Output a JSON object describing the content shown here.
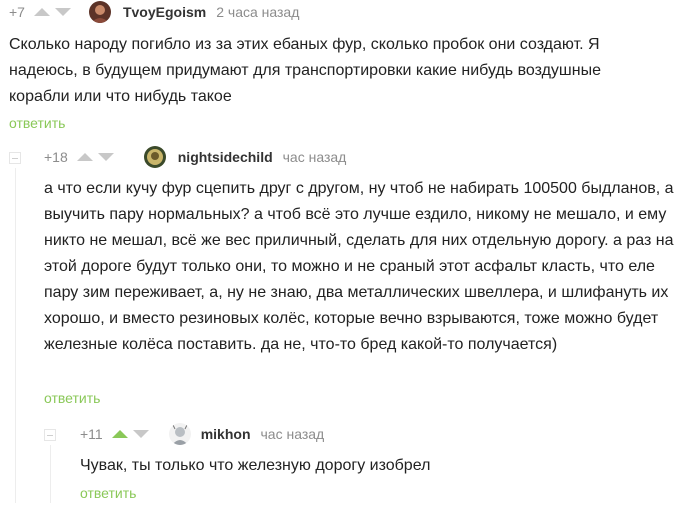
{
  "comments": [
    {
      "rating": "+7",
      "author": "TvoyEgoism",
      "time": "2 часа назад",
      "avatar_color": "#8a4a3a",
      "text": "Сколько народу погибло из за этих ебаных фур, сколько пробок они создают. Я надеюсь, в будущем придумают для транспортировки какие нибудь воздушные корабли или что нибудь такое",
      "reply_label": "ответить"
    },
    {
      "rating": "+18",
      "author": "nightsidechild",
      "time": "час назад",
      "avatar_color": "#5a6e3a",
      "text": "а что если кучу фур сцепить друг с другом, ну чтоб не набирать 100500 быдланов, а выучить пару нормальных? а чтоб всё это лучше ездило, никому не мешало, и ему никто не мешал, всё же вес приличный, сделать для них отдельную дорогу. а раз на этой дороге будут только они, то можно и не сраный этот асфальт класть, что еле пару зим переживает, а, ну не знаю, два металлических швеллера, и шлифануть их хорошо, и вместо резиновых колёс, которые вечно взрываются, тоже можно будет железные колёса поставить. да не, что-то бред какой-то получается)",
      "reply_label": "ответить"
    },
    {
      "rating": "+11",
      "author": "mikhon",
      "time": "час назад",
      "avatar_color": "#9aa0a6",
      "upvoted": true,
      "upvote_color": "#8ac858",
      "text": "Чувак, ты только что железную дорогу изобрел",
      "reply_label": "ответить"
    }
  ]
}
